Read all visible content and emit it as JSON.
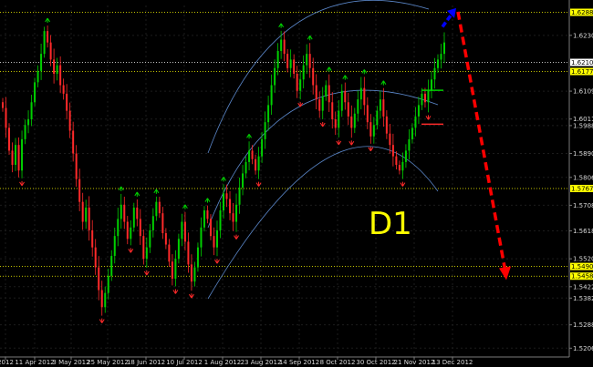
{
  "chart_data": {
    "type": "candlestick",
    "timeframe_label": "D1",
    "x_tick_labels": [
      "2012",
      "11 Apr 2012",
      "3 May 2012",
      "25 May 2012",
      "18 Jun 2012",
      "10 Jul 2012",
      "1 Aug 2012",
      "23 Aug 2012",
      "14 Sep 2012",
      "8 Oct 2012",
      "30 Oct 2012",
      "21 Nov 2012",
      "13 Dec 2012"
    ],
    "y_ticks": [
      1.6305,
      1.6109,
      1.6011,
      1.5988,
      1.589,
      1.5806,
      1.5708,
      1.5618,
      1.552,
      1.5422,
      1.5382,
      1.5288,
      1.5206
    ],
    "y_tick_labels": [
      "1.62305",
      "1.61090",
      "1.60110",
      "1.59880",
      "1.58900",
      "1.58060",
      "1.57080",
      "1.56180",
      "1.55200",
      "1.54220",
      "1.53820",
      "1.52880",
      "1.52060"
    ],
    "ylim": [
      1.5175,
      1.641
    ],
    "highlighted_levels": [
      {
        "value": 1.6386,
        "label": "1.62882",
        "color": "#ffff00"
      },
      {
        "value": 1.621,
        "label": "1.62100",
        "color": "#ffffff"
      },
      {
        "value": 1.6178,
        "label": "1.61778",
        "color": "#ffff00"
      },
      {
        "value": 1.5767,
        "label": "1.57672",
        "color": "#ffff00"
      },
      {
        "value": 1.5493,
        "label": "1.54903",
        "color": "#ffff00"
      },
      {
        "value": 1.5459,
        "label": "1.54588",
        "color": "#ffff00"
      }
    ],
    "series": [
      {
        "type": "candles",
        "up_color": "#00d000",
        "down_color": "#ff2a2a",
        "closes": [
          1.605,
          1.598,
          1.59,
          1.585,
          1.592,
          1.583,
          1.594,
          1.599,
          1.601,
          1.607,
          1.614,
          1.618,
          1.624,
          1.632,
          1.628,
          1.622,
          1.617,
          1.62,
          1.613,
          1.61,
          1.604,
          1.597,
          1.589,
          1.58,
          1.572,
          1.565,
          1.57,
          1.562,
          1.556,
          1.549,
          1.541,
          1.535,
          1.54,
          1.546,
          1.553,
          1.56,
          1.566,
          1.571,
          1.565,
          1.559,
          1.563,
          1.57,
          1.566,
          1.56,
          1.552,
          1.556,
          1.562,
          1.567,
          1.572,
          1.568,
          1.561,
          1.557,
          1.551,
          1.545,
          1.552,
          1.559,
          1.565,
          1.558,
          1.55,
          1.544,
          1.549,
          1.556,
          1.563,
          1.569,
          1.566,
          1.56,
          1.556,
          1.562,
          1.569,
          1.575,
          1.573,
          1.568,
          1.565,
          1.571,
          1.577,
          1.582,
          1.586,
          1.59,
          1.587,
          1.583,
          1.588,
          1.594,
          1.6,
          1.606,
          1.613,
          1.619,
          1.625,
          1.629,
          1.624,
          1.619,
          1.622,
          1.617,
          1.611,
          1.615,
          1.62,
          1.624,
          1.619,
          1.613,
          1.608,
          1.604,
          1.609,
          1.613,
          1.607,
          1.601,
          1.598,
          1.604,
          1.611,
          1.607,
          1.602,
          1.598,
          1.603,
          1.608,
          1.612,
          1.606,
          1.6,
          1.595,
          1.599,
          1.604,
          1.608,
          1.602,
          1.596,
          1.592,
          1.588,
          1.585,
          1.583,
          1.586,
          1.59,
          1.594,
          1.598,
          1.602,
          1.606,
          1.61,
          1.607,
          1.611,
          1.615,
          1.619,
          1.622,
          1.624,
          1.628
        ]
      },
      {
        "type": "envelope_curves",
        "color": "#5a86c8"
      }
    ],
    "annotations": [
      {
        "type": "arrow",
        "color": "#0000ff",
        "style": "dashed",
        "from": {
          "x": "13 Dec 2012",
          "y": 1.6335
        },
        "to": {
          "x": "13 Dec 2012",
          "y": 1.6388
        }
      },
      {
        "type": "arrow",
        "color": "#ff0000",
        "style": "dashed",
        "from": {
          "x": "13 Dec 2012",
          "y": 1.6388
        },
        "to": {
          "x": "after 13 Dec 2012",
          "y": 1.5455
        }
      }
    ]
  }
}
